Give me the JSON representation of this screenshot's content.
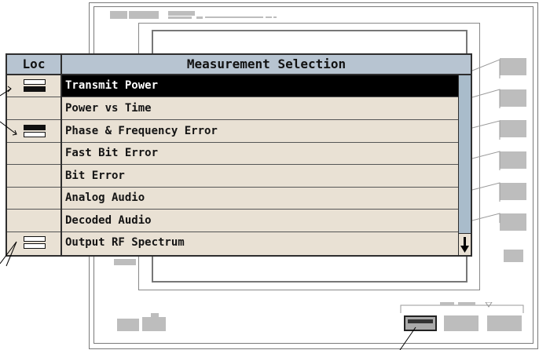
{
  "dialog": {
    "loc_header": "Loc",
    "title": "Measurement Selection",
    "items": [
      {
        "label": "Transmit Power",
        "selected": true,
        "key": "bottom-filled"
      },
      {
        "label": "Power vs Time",
        "selected": false,
        "key": ""
      },
      {
        "label": "Phase & Frequency Error",
        "selected": false,
        "key": "top-filled"
      },
      {
        "label": "Fast Bit Error",
        "selected": false,
        "key": ""
      },
      {
        "label": "Bit Error",
        "selected": false,
        "key": ""
      },
      {
        "label": "Analog Audio",
        "selected": false,
        "key": ""
      },
      {
        "label": "Decoded Audio",
        "selected": false,
        "key": ""
      },
      {
        "label": "Output RF Spectrum",
        "selected": false,
        "key": "outline"
      }
    ],
    "scroll_icon": "down-arrow-icon"
  },
  "colors": {
    "dialog_bg": "#e9e1d4",
    "header_bg": "#b7c4d1",
    "selected_bg": "#000000",
    "scrollbar": "#a9bccb",
    "frame_gray": "#bdbdbd"
  }
}
